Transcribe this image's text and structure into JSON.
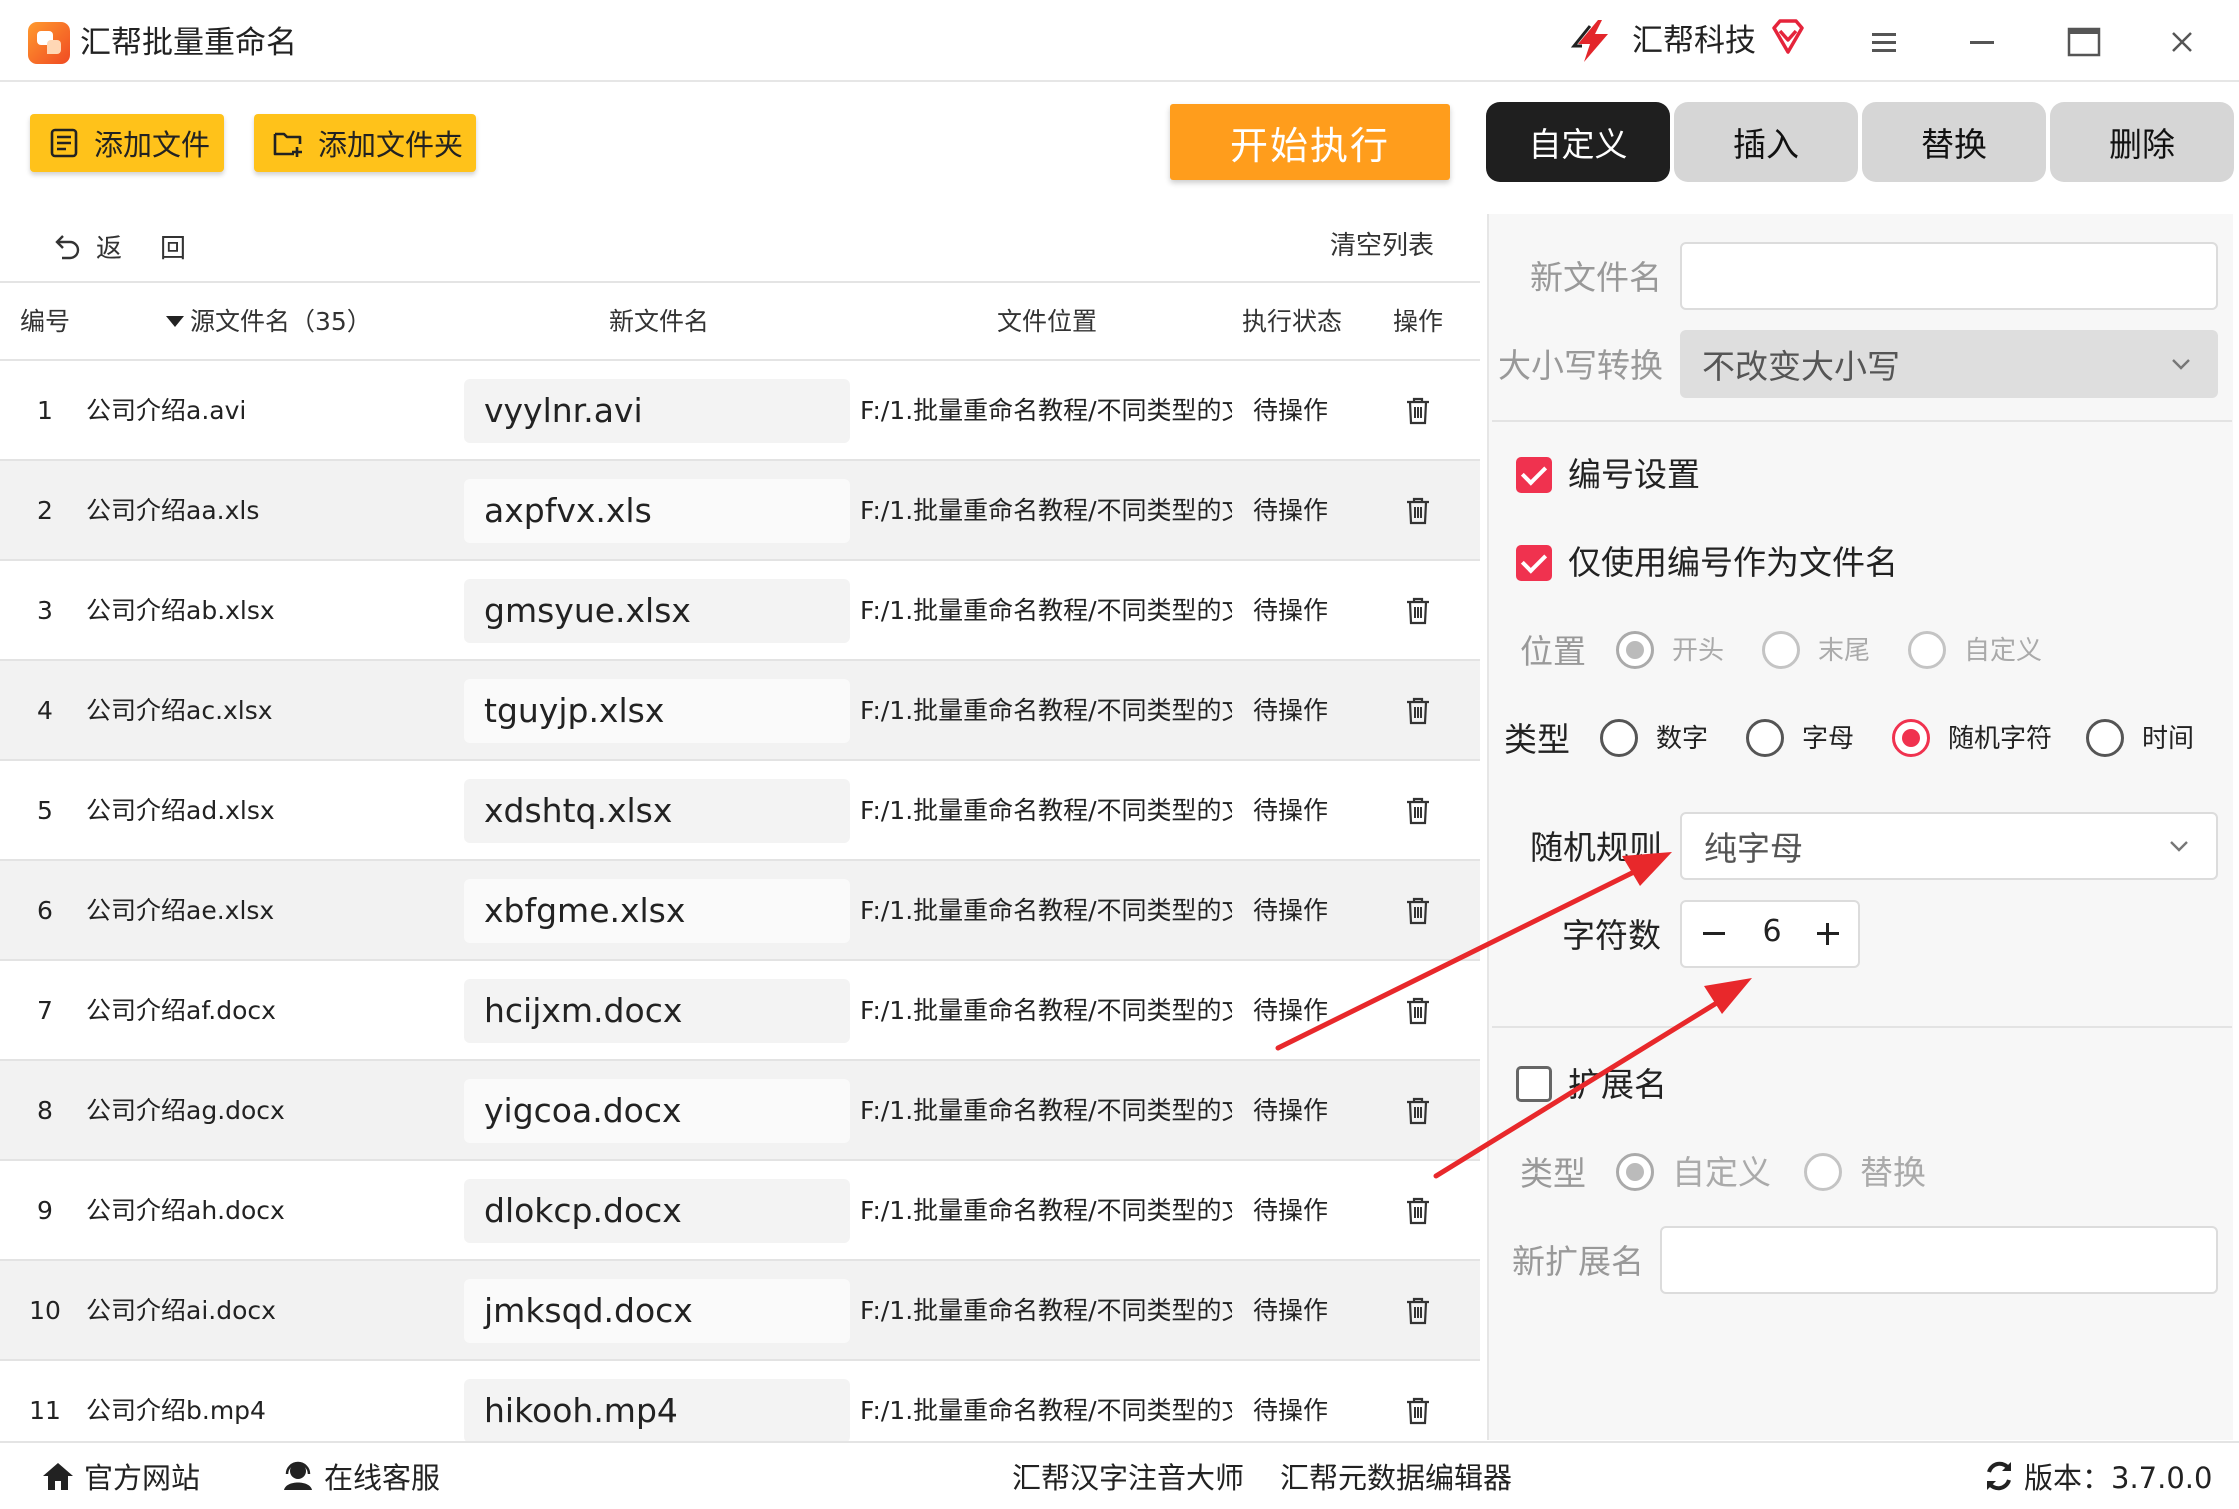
{
  "window": {
    "app_title": "汇帮批量重命名",
    "brand_name": "汇帮科技"
  },
  "toolbar": {
    "add_file_label": "添加文件",
    "add_folder_label": "添加文件夹",
    "start_label": "开始执行"
  },
  "tabs": [
    {
      "label": "自定义",
      "active": true
    },
    {
      "label": "插入",
      "active": false
    },
    {
      "label": "替换",
      "active": false
    },
    {
      "label": "删除",
      "active": false
    }
  ],
  "list": {
    "back_label": "返回",
    "clear_label": "清空列表",
    "headers": {
      "num": "编号",
      "source": "源文件名（35）",
      "new_name": "新文件名",
      "location": "文件位置",
      "status": "执行状态",
      "action": "操作"
    },
    "rows": [
      {
        "num": "1",
        "source": "公司介绍a.avi",
        "new_name": "vyylnr.avi",
        "location": "F:/1.批量重命名教程/不同类型的文",
        "status": "待操作"
      },
      {
        "num": "2",
        "source": "公司介绍aa.xls",
        "new_name": "axpfvx.xls",
        "location": "F:/1.批量重命名教程/不同类型的文",
        "status": "待操作"
      },
      {
        "num": "3",
        "source": "公司介绍ab.xlsx",
        "new_name": "gmsyue.xlsx",
        "location": "F:/1.批量重命名教程/不同类型的文",
        "status": "待操作"
      },
      {
        "num": "4",
        "source": "公司介绍ac.xlsx",
        "new_name": "tguyjp.xlsx",
        "location": "F:/1.批量重命名教程/不同类型的文",
        "status": "待操作"
      },
      {
        "num": "5",
        "source": "公司介绍ad.xlsx",
        "new_name": "xdshtq.xlsx",
        "location": "F:/1.批量重命名教程/不同类型的文",
        "status": "待操作"
      },
      {
        "num": "6",
        "source": "公司介绍ae.xlsx",
        "new_name": "xbfgme.xlsx",
        "location": "F:/1.批量重命名教程/不同类型的文",
        "status": "待操作"
      },
      {
        "num": "7",
        "source": "公司介绍af.docx",
        "new_name": "hcijxm.docx",
        "location": "F:/1.批量重命名教程/不同类型的文",
        "status": "待操作"
      },
      {
        "num": "8",
        "source": "公司介绍ag.docx",
        "new_name": "yigcoa.docx",
        "location": "F:/1.批量重命名教程/不同类型的文",
        "status": "待操作"
      },
      {
        "num": "9",
        "source": "公司介绍ah.docx",
        "new_name": "dlokcp.docx",
        "location": "F:/1.批量重命名教程/不同类型的文",
        "status": "待操作"
      },
      {
        "num": "10",
        "source": "公司介绍ai.docx",
        "new_name": "jmksqd.docx",
        "location": "F:/1.批量重命名教程/不同类型的文",
        "status": "待操作"
      },
      {
        "num": "11",
        "source": "公司介绍b.mp4",
        "new_name": "hikooh.mp4",
        "location": "F:/1.批量重命名教程/不同类型的文",
        "status": "待操作"
      }
    ]
  },
  "panel": {
    "new_filename_label": "新文件名",
    "new_filename_value": "",
    "case_label": "大小写转换",
    "case_value": "不改变大小写",
    "numbering_label": "编号设置",
    "numbering_checked": true,
    "only_number_label": "仅使用编号作为文件名",
    "only_number_checked": true,
    "position_label": "位置",
    "position_options": [
      "开头",
      "末尾",
      "自定义"
    ],
    "position_selected": "开头",
    "type_label": "类型",
    "type_options": [
      "数字",
      "字母",
      "随机字符",
      "时间"
    ],
    "type_selected": "随机字符",
    "random_rule_label": "随机规则",
    "random_rule_value": "纯字母",
    "char_count_label": "字符数",
    "char_count_value": "6",
    "extension_label": "扩展名",
    "extension_checked": false,
    "ext_type_label": "类型",
    "ext_type_options": [
      "自定义",
      "替换"
    ],
    "ext_type_selected": "自定义",
    "new_ext_label": "新扩展名",
    "new_ext_value": ""
  },
  "footer": {
    "website": "官方网站",
    "support": "在线客服",
    "pinyin_tool": "汇帮汉字注音大师",
    "metadata_tool": "汇帮元数据编辑器",
    "version": "版本：3.7.0.0"
  },
  "colors": {
    "accent_yellow": "#ffc21a",
    "start_orange": "#ff9d1c",
    "check_red": "#f0324f",
    "tab_active": "#1f1f1f",
    "tab_inactive": "#d6d6d6",
    "arrow_red": "#e8282b"
  },
  "icons": {
    "app_logo": "app-logo-icon",
    "brand_logo": "brand-bolt-icon",
    "vip": "vip-diamond-icon",
    "menu": "hamburger-icon",
    "minimize": "minimize-icon",
    "maximize": "maximize-icon",
    "close": "close-icon",
    "add_file": "file-list-icon",
    "add_folder": "folder-plus-icon",
    "back": "undo-arrow-icon",
    "delete": "trash-icon",
    "home": "home-icon",
    "support": "headset-icon",
    "version": "refresh-icon"
  }
}
